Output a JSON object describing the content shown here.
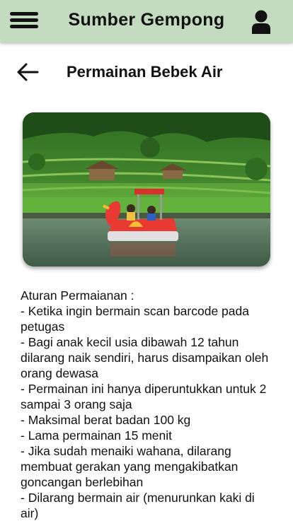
{
  "app": {
    "title": "Sumber Gempong"
  },
  "page": {
    "title": "Permainan Bebek Air"
  },
  "hero_image": {
    "alt": "Perahu bebek air di kolam dengan latar sawah terasering"
  },
  "rules": {
    "heading": "Aturan Permaianan :",
    "items": [
      "- Ketika ingin bermain scan barcode pada petugas",
      "- Bagi anak kecil usia dibawah 12 tahun dilarang naik sendiri, harus disampaikan oleh orang dewasa",
      "- Permainan ini hanya diperuntukkan untuk 2 sampai 3 orang saja",
      "- Maksimal berat badan 100 kg",
      "- Lama permainan 15 menit",
      "- Jika sudah menaiki wahana, dilarang membuat gerakan yang mengakibatkan goncangan berlebihan",
      "- Dilarang bermain air (menurunkan kaki di air)"
    ]
  },
  "colors": {
    "appbar": "#c3dcbf",
    "text": "#111111"
  }
}
